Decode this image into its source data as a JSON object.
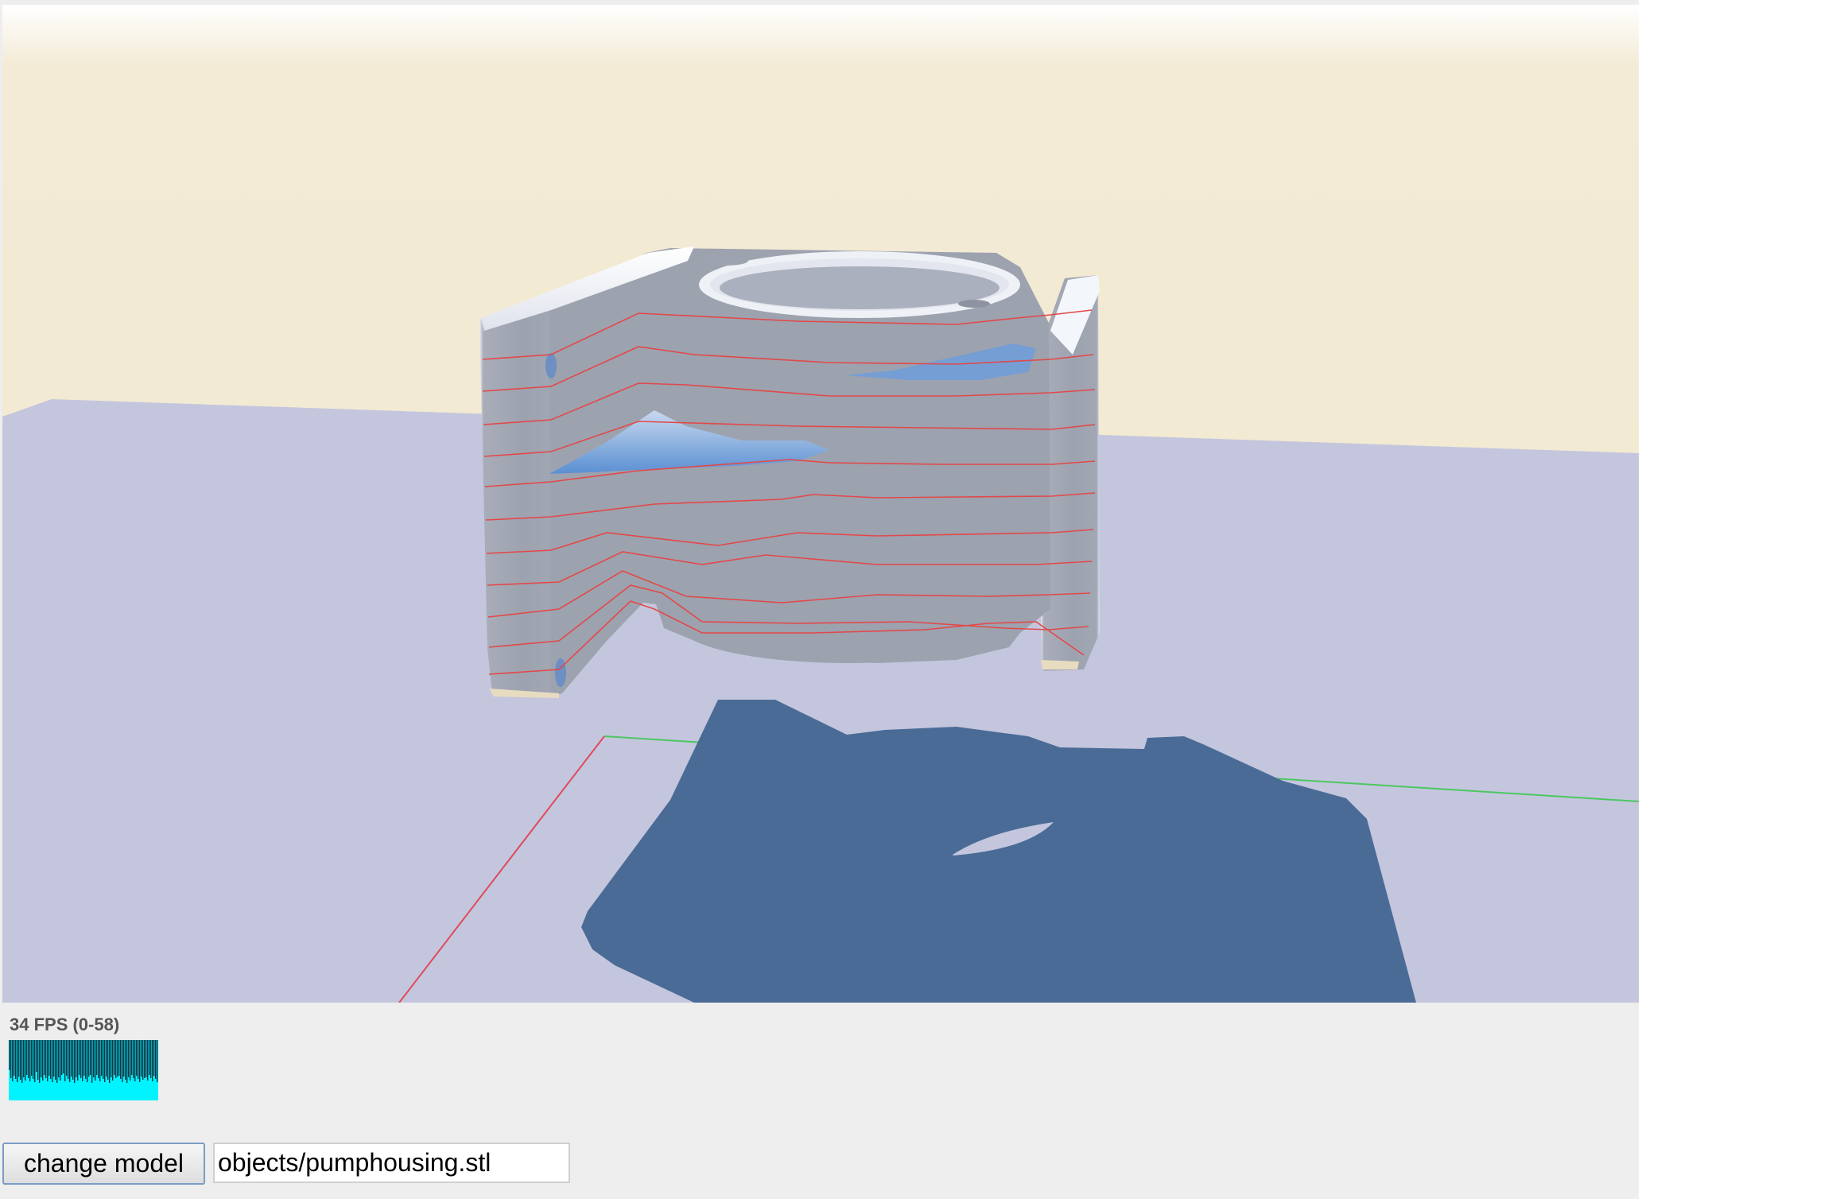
{
  "viewer": {
    "scene": "3d-stl-viewer",
    "colors": {
      "sky_top": "#ffffff",
      "sky_bottom": "#f2e8cf",
      "ground": "#c4c6de",
      "shadow": "#4a6b96",
      "model": "#9ea3b0",
      "model_highlight": "#ffffff",
      "interior": "#5b93d8",
      "slice_lines": "#e34848",
      "x_axis": "#e04a5a",
      "y_axis": "#4cc760"
    }
  },
  "stats": {
    "fps_label": "34 FPS (0-58)",
    "graph_bg": "#00f3ff",
    "graph_bar": "#113344"
  },
  "controls": {
    "change_model_label": "change model",
    "model_path_value": "objects/pumphousing.stl"
  }
}
